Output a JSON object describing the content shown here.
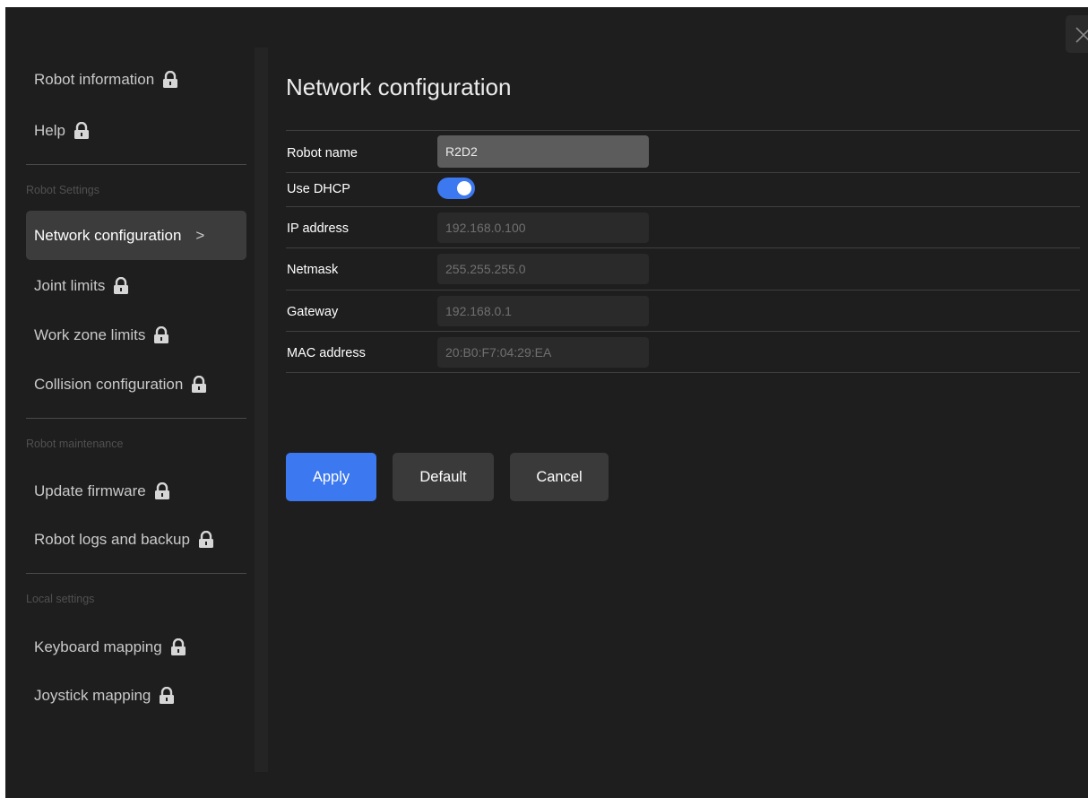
{
  "sidebar": {
    "top_items": [
      {
        "label": "Robot information",
        "locked": true
      },
      {
        "label": "Help",
        "locked": true
      }
    ],
    "sections": [
      {
        "title": "Robot Settings",
        "items": [
          {
            "label": "Network configuration",
            "active": true,
            "locked": false
          },
          {
            "label": "Joint limits",
            "locked": true
          },
          {
            "label": "Work zone limits",
            "locked": true
          },
          {
            "label": "Collision configuration",
            "locked": true
          }
        ]
      },
      {
        "title": "Robot maintenance",
        "items": [
          {
            "label": "Update firmware",
            "locked": true
          },
          {
            "label": "Robot logs and backup",
            "locked": true
          }
        ]
      },
      {
        "title": "Local settings",
        "items": [
          {
            "label": "Keyboard mapping",
            "locked": true
          },
          {
            "label": "Joystick mapping",
            "locked": true
          }
        ]
      }
    ],
    "chevron": ">"
  },
  "main": {
    "title": "Network configuration",
    "form": {
      "robot_name": {
        "label": "Robot name",
        "value": "R2D2"
      },
      "use_dhcp": {
        "label": "Use DHCP",
        "enabled": true
      },
      "ip_address": {
        "label": "IP address",
        "value": "192.168.0.100"
      },
      "netmask": {
        "label": "Netmask",
        "value": "255.255.255.0"
      },
      "gateway": {
        "label": "Gateway",
        "value": "192.168.0.1"
      },
      "mac_address": {
        "label": "MAC address",
        "value": "20:B0:F7:04:29:EA"
      }
    },
    "buttons": {
      "apply": "Apply",
      "default": "Default",
      "cancel": "Cancel"
    }
  },
  "icons": {
    "lock": "lock-icon",
    "close": "close-icon",
    "chevron": "chevron-right-icon"
  },
  "colors": {
    "background": "#1e1e1e",
    "accent": "#3c78f0",
    "active_item": "#3c3c3c"
  }
}
